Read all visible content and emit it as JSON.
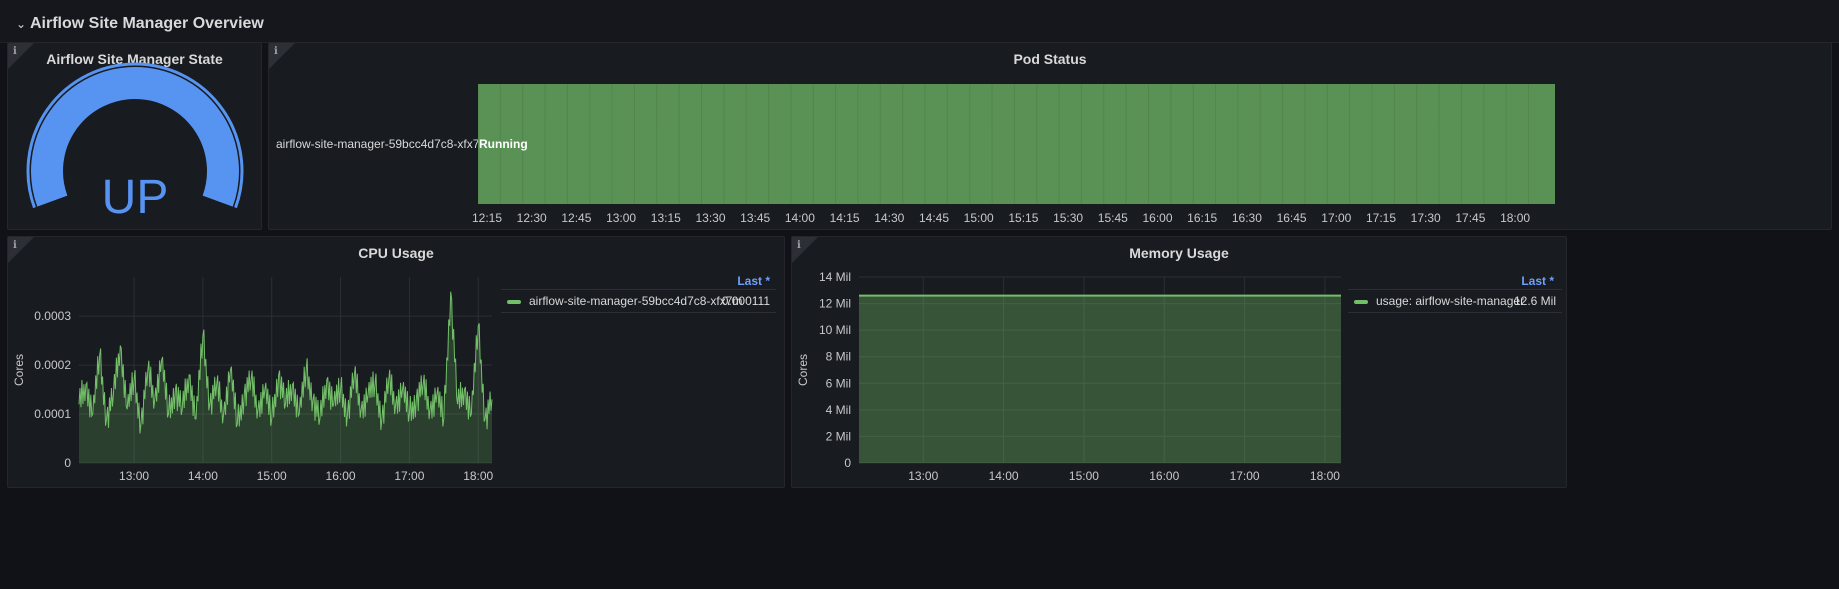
{
  "row": {
    "chevron": "⌄",
    "title": "Airflow Site Manager Overview"
  },
  "info_glyph": "i",
  "colors": {
    "gauge": "#5794f2",
    "green": "#73bf69",
    "pod_fill": "#5a9155"
  },
  "gauge_panel": {
    "title": "Airflow Site Manager State",
    "value": "UP"
  },
  "pod_panel": {
    "title": "Pod Status",
    "pod_name": "airflow-site-manager-59bcc4d7c8-xfx7m",
    "state": "Running",
    "time_ticks": [
      "12:15",
      "12:30",
      "12:45",
      "13:00",
      "13:15",
      "13:30",
      "13:45",
      "14:00",
      "14:15",
      "14:30",
      "14:45",
      "15:00",
      "15:15",
      "15:30",
      "15:45",
      "16:00",
      "16:15",
      "16:30",
      "16:45",
      "17:00",
      "17:15",
      "17:30",
      "17:45",
      "18:00"
    ]
  },
  "cpu_panel": {
    "title": "CPU Usage",
    "legend_header": "Last *",
    "legend_name": "airflow-site-manager-59bcc4d7c8-xfx7m",
    "legend_value": "0.000111"
  },
  "mem_panel": {
    "title": "Memory Usage",
    "legend_header": "Last *",
    "legend_name": "usage: airflow-site-manager",
    "legend_value": "12.6 Mil"
  },
  "chart_data": [
    {
      "type": "line",
      "title": "CPU Usage",
      "ylabel": "Cores",
      "x_ticks": [
        "13:00",
        "14:00",
        "15:00",
        "16:00",
        "17:00",
        "18:00"
      ],
      "y_ticks": [
        "0",
        "0.0001",
        "0.0002",
        "0.0003"
      ],
      "ylim": [
        0,
        0.00038
      ],
      "xlim_hours": [
        12.2,
        18.2
      ],
      "series": [
        {
          "name": "airflow-site-manager-59bcc4d7c8-xfx7m",
          "x_hours": [
            12.2,
            12.3,
            12.4,
            12.5,
            12.6,
            12.7,
            12.8,
            12.9,
            13.0,
            13.1,
            13.2,
            13.3,
            13.4,
            13.5,
            13.6,
            13.7,
            13.8,
            13.9,
            14.0,
            14.1,
            14.2,
            14.3,
            14.4,
            14.5,
            14.6,
            14.7,
            14.8,
            14.9,
            15.0,
            15.1,
            15.2,
            15.3,
            15.4,
            15.5,
            15.6,
            15.7,
            15.8,
            15.9,
            16.0,
            16.1,
            16.2,
            16.3,
            16.4,
            16.5,
            16.6,
            16.7,
            16.8,
            16.9,
            17.0,
            17.1,
            17.2,
            17.3,
            17.4,
            17.5,
            17.6,
            17.7,
            17.8,
            17.9,
            18.0,
            18.1,
            18.2
          ],
          "values": [
            0.00012,
            0.00016,
            0.0001,
            0.00022,
            9e-05,
            0.00014,
            0.00024,
            0.00011,
            0.00017,
            8e-05,
            0.00019,
            0.00013,
            0.00021,
            0.0001,
            0.00015,
            0.00011,
            0.00018,
            9e-05,
            0.00026,
            0.00012,
            0.00016,
            0.0001,
            0.00019,
            8e-05,
            0.00014,
            0.00017,
            0.00011,
            0.00015,
            9e-05,
            0.00018,
            0.00012,
            0.00016,
            0.0001,
            0.00019,
            0.00013,
            9e-05,
            0.00017,
            0.00012,
            0.00015,
            0.0001,
            0.00018,
            0.00011,
            0.00014,
            0.00016,
            9e-05,
            0.00017,
            0.00012,
            0.00015,
            0.0001,
            0.00013,
            0.00016,
            0.00011,
            0.00014,
            9e-05,
            0.00035,
            0.00012,
            0.00015,
            0.0001,
            0.00028,
            9e-05,
            0.00013
          ]
        }
      ]
    },
    {
      "type": "area",
      "title": "Memory Usage",
      "ylabel": "Cores",
      "x_ticks": [
        "13:00",
        "14:00",
        "15:00",
        "16:00",
        "17:00",
        "18:00"
      ],
      "y_ticks": [
        "0",
        "2 Mil",
        "4 Mil",
        "6 Mil",
        "8 Mil",
        "10 Mil",
        "12 Mil",
        "14 Mil"
      ],
      "ylim": [
        0,
        14
      ],
      "xlim_hours": [
        12.2,
        18.2
      ],
      "series": [
        {
          "name": "usage: airflow-site-manager",
          "x_hours": [
            12.2,
            18.2
          ],
          "values": [
            12.6,
            12.6
          ]
        }
      ]
    }
  ]
}
